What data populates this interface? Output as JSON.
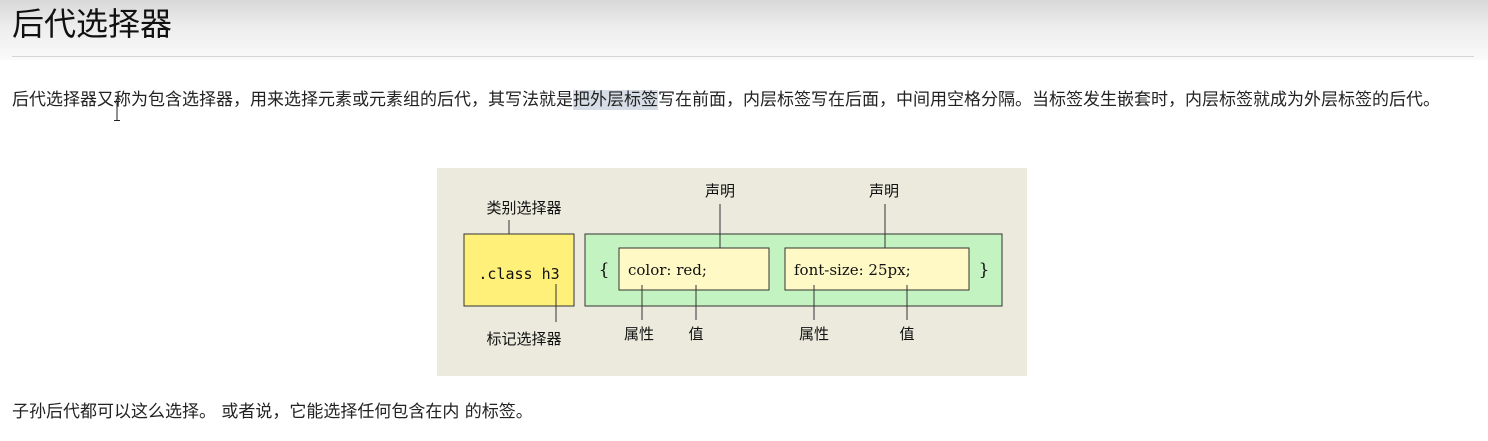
{
  "header": {
    "title": "后代选择器"
  },
  "intro": {
    "text_before": "后代选择器又称为包含选择器，用来选择元素或元素组的后代，其写法就是",
    "highlight": "把外层标签",
    "text_after": "写在前面，内层标签写在后面，中间用空格分隔。当标签发生嵌套时，内层标签就成为外层标签的后代。"
  },
  "diagram": {
    "label_class_selector": "类别选择器",
    "label_tag_selector": "标记选择器",
    "selector_code": ".class h3",
    "brace_open": "{",
    "brace_close": "}",
    "decl1": {
      "text": "color: red;",
      "label": "声明",
      "property_label": "属性",
      "value_label": "值"
    },
    "decl2": {
      "text": "font-size: 25px;",
      "label": "声明",
      "property_label": "属性",
      "value_label": "值"
    }
  },
  "footer": {
    "text": "子孙后代都可以这么选择。 或者说，它能选择任何包含在内 的标签。"
  },
  "colors": {
    "figure_bg": "#ebeadd",
    "selector_box": "#fff07a",
    "decl_group": "#c4f3c2",
    "decl_box": "#fff9c6",
    "highlight": "#d6dde6"
  }
}
